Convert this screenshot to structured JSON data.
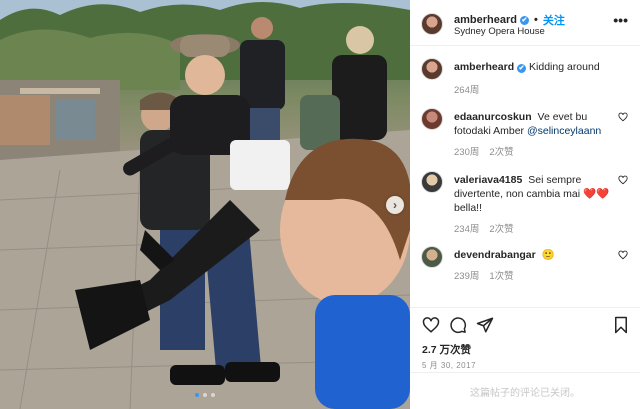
{
  "post": {
    "username": "amberheard",
    "follow_label": "关注",
    "separator": "•",
    "location": "Sydney Opera House",
    "caption": "Kidding around",
    "caption_time": "264周",
    "likes": "2.7 万次赞",
    "date": "5 月 30, 2017",
    "comments_closed": "这篇帖子的评论已关闭。"
  },
  "comments": [
    {
      "username": "edaanurcoskun",
      "text_before": "Ve evet bu fotodaki Amber ",
      "mention": "@selinceylaann",
      "text_after": "",
      "time": "230周",
      "likes": "2次赞"
    },
    {
      "username": "valeriava4185",
      "text_before": "Sei sempre divertente, non cambia mai ",
      "emoji": "❤️❤️",
      "text_after": " bella!!",
      "time": "234周",
      "likes": "2次赞"
    },
    {
      "username": "devendrabangar",
      "text_before": "",
      "emoji": "🙂",
      "text_after": "",
      "time": "239周",
      "likes": "1次赞"
    }
  ],
  "icons": {
    "verified": "✔",
    "more": "•••",
    "next": "›"
  },
  "colors": {
    "link_blue": "#0095f6",
    "mention_blue": "#00376b",
    "verified_blue": "#3897f0",
    "meta_grey": "#8e8e8e"
  },
  "carousel": {
    "count": 3,
    "active": 1
  }
}
